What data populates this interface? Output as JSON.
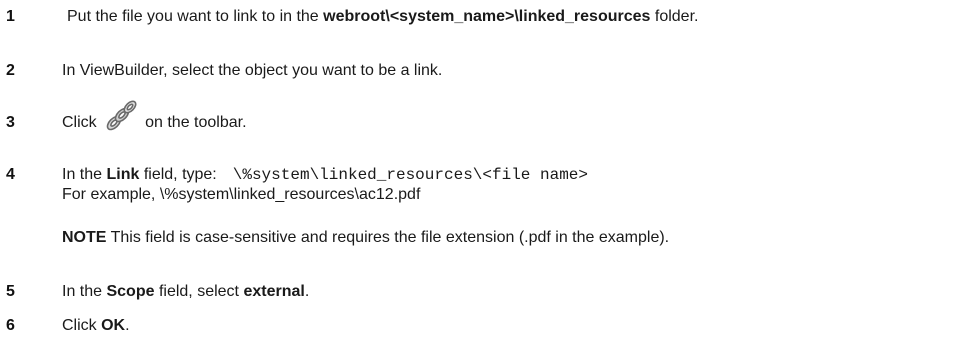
{
  "steps": [
    {
      "num": "1",
      "pre": "Put the file you want to link to in the ",
      "bold": "webroot\\<system_name>\\linked_resources",
      "post": " folder."
    },
    {
      "num": "2",
      "text": "In ViewBuilder, select the object you want to be a link."
    },
    {
      "num": "3",
      "pre": "Click ",
      "icon": "link-chain-icon",
      "post": "on the toolbar."
    },
    {
      "num": "4",
      "pre": "In the ",
      "bold": "Link",
      "post": " field, type:",
      "code": "\\%system\\linked_resources\\<file name>",
      "line2": "For example, \\%system\\linked_resources\\ac12.pdf"
    },
    {
      "note_label": "NOTE",
      "note_text": " This field is case-sensitive and requires the file extension (.pdf in the example)."
    },
    {
      "num": "5",
      "pre": "In the ",
      "bold": "Scope",
      "mid": " field, select ",
      "bold2": "external",
      "post": "."
    },
    {
      "num": "6",
      "pre": "Click ",
      "bold": "OK",
      "post": "."
    }
  ]
}
